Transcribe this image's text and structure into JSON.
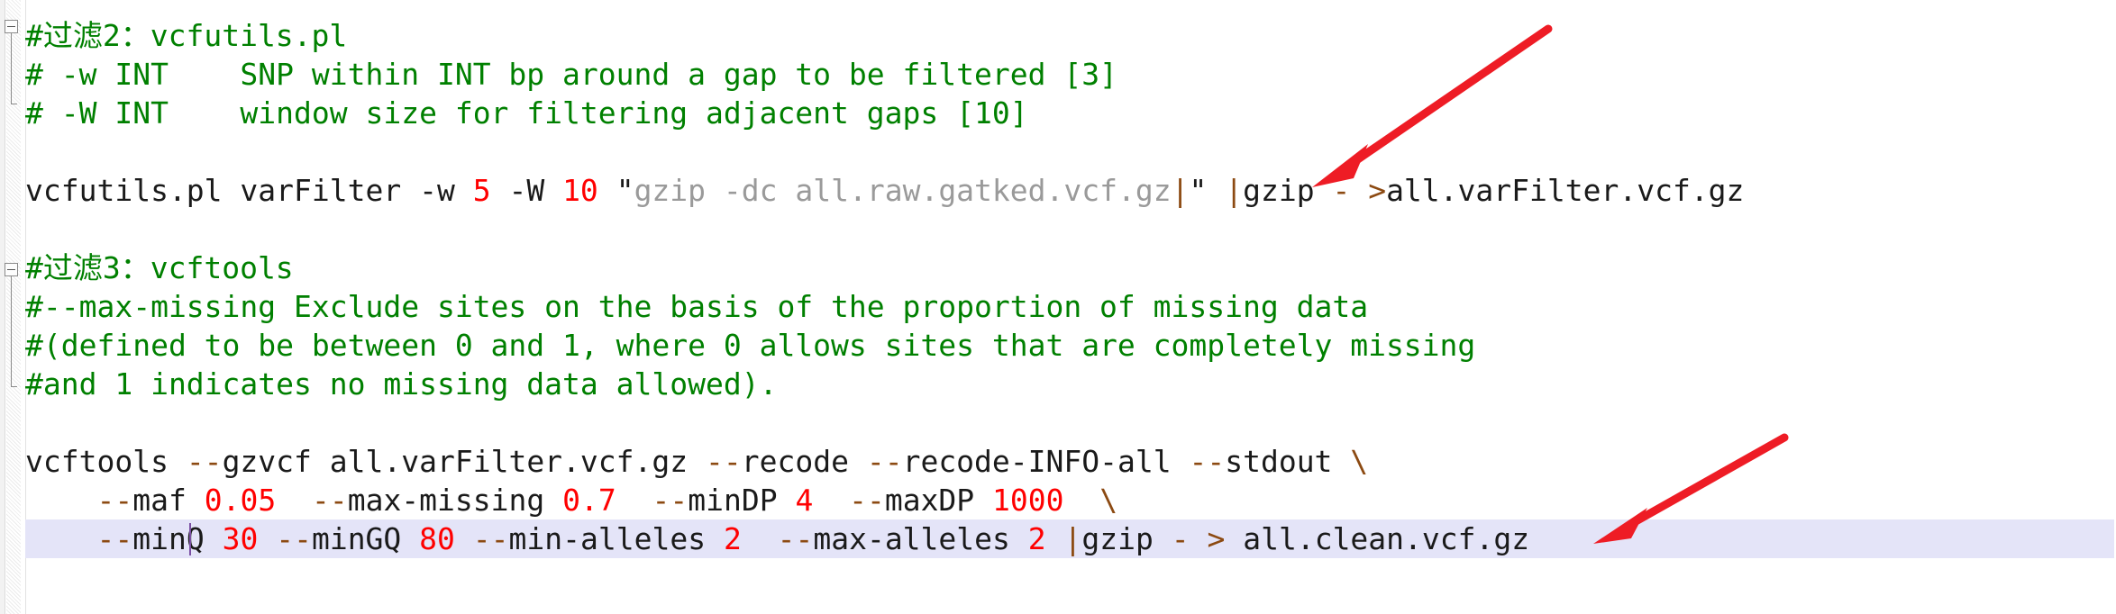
{
  "editor": {
    "title": "code-editor",
    "colors": {
      "comment": "#008000",
      "text": "#1a1a1a",
      "number": "#ff0000",
      "string": "#9a9a9a",
      "operator": "#8c4a12",
      "current_line_highlight": "#e4e4f8",
      "annotation_arrow": "#ee1c25",
      "background": "#ffffff"
    },
    "lines": [
      {
        "id": 1,
        "kind": "comment",
        "fold": "open",
        "text": "#过滤2：vcfutils.pl",
        "tokens": [
          {
            "t": "#过滤2：vcfutils.pl",
            "c": "comment"
          }
        ]
      },
      {
        "id": 2,
        "kind": "comment",
        "text": "# -w INT    SNP within INT bp around a gap to be filtered [3]",
        "tokens": [
          {
            "t": "# -w INT    SNP within INT bp around a gap to be filtered [3]",
            "c": "comment"
          }
        ]
      },
      {
        "id": 3,
        "kind": "comment",
        "text": "# -W INT    window size for filtering adjacent gaps [10]",
        "tokens": [
          {
            "t": "# -W INT    window size for filtering adjacent gaps [10]",
            "c": "comment"
          }
        ]
      },
      {
        "id": 4,
        "kind": "blank",
        "text": "",
        "tokens": []
      },
      {
        "id": 5,
        "kind": "command",
        "text": "vcfutils.pl varFilter -w 5 -W 10 \"gzip -dc all.raw.gatked.vcf.gz|\" |gzip - >all.varFilter.vcf.gz",
        "tokens": [
          {
            "t": "vcfutils.pl varFilter -w ",
            "c": "text"
          },
          {
            "t": "5",
            "c": "number"
          },
          {
            "t": " -W ",
            "c": "text"
          },
          {
            "t": "10",
            "c": "number"
          },
          {
            "t": " ",
            "c": "text"
          },
          {
            "t": "\"",
            "c": "text"
          },
          {
            "t": "gzip -dc all.raw.gatked.vcf.gz",
            "c": "string"
          },
          {
            "t": "|",
            "c": "operator"
          },
          {
            "t": "\"",
            "c": "text"
          },
          {
            "t": " ",
            "c": "text"
          },
          {
            "t": "|",
            "c": "operator"
          },
          {
            "t": "gzip ",
            "c": "text"
          },
          {
            "t": "-",
            "c": "operator"
          },
          {
            "t": " ",
            "c": "text"
          },
          {
            "t": ">",
            "c": "operator"
          },
          {
            "t": "all.varFilter.vcf.gz",
            "c": "text"
          }
        ]
      },
      {
        "id": 6,
        "kind": "blank",
        "text": "",
        "tokens": []
      },
      {
        "id": 7,
        "kind": "comment",
        "fold": "open",
        "text": "#过滤3：vcftools",
        "tokens": [
          {
            "t": "#过滤3：vcftools",
            "c": "comment"
          }
        ]
      },
      {
        "id": 8,
        "kind": "comment",
        "text": "#--max-missing Exclude sites on the basis of the proportion of missing data",
        "tokens": [
          {
            "t": "#--max-missing Exclude sites on the basis of the proportion of missing data",
            "c": "comment"
          }
        ]
      },
      {
        "id": 9,
        "kind": "comment",
        "text": "#(defined to be between 0 and 1, where 0 allows sites that are completely missing",
        "tokens": [
          {
            "t": "#(defined to be between 0 and 1, where 0 allows sites that are completely missing",
            "c": "comment"
          }
        ]
      },
      {
        "id": 10,
        "kind": "comment",
        "text": "#and 1 indicates no missing data allowed).",
        "tokens": [
          {
            "t": "#and 1 indicates no missing data allowed).",
            "c": "comment"
          }
        ]
      },
      {
        "id": 11,
        "kind": "blank",
        "text": "",
        "tokens": []
      },
      {
        "id": 12,
        "kind": "command",
        "text": "vcftools --gzvcf all.varFilter.vcf.gz --recode --recode-INFO-all --stdout \\",
        "tokens": [
          {
            "t": "vcftools ",
            "c": "text"
          },
          {
            "t": "--",
            "c": "operator"
          },
          {
            "t": "gzvcf all.varFilter.vcf.gz ",
            "c": "text"
          },
          {
            "t": "--",
            "c": "operator"
          },
          {
            "t": "recode ",
            "c": "text"
          },
          {
            "t": "--",
            "c": "operator"
          },
          {
            "t": "recode-INFO-all ",
            "c": "text"
          },
          {
            "t": "--",
            "c": "operator"
          },
          {
            "t": "stdout ",
            "c": "text"
          },
          {
            "t": "\\",
            "c": "operator"
          }
        ]
      },
      {
        "id": 13,
        "kind": "command",
        "text": "    --maf 0.05  --max-missing 0.7  --minDP 4  --maxDP 1000  \\",
        "tokens": [
          {
            "t": "    ",
            "c": "text"
          },
          {
            "t": "--",
            "c": "operator"
          },
          {
            "t": "maf ",
            "c": "text"
          },
          {
            "t": "0.05",
            "c": "number"
          },
          {
            "t": "  ",
            "c": "text"
          },
          {
            "t": "--",
            "c": "operator"
          },
          {
            "t": "max-missing ",
            "c": "text"
          },
          {
            "t": "0.7",
            "c": "number"
          },
          {
            "t": "  ",
            "c": "text"
          },
          {
            "t": "--",
            "c": "operator"
          },
          {
            "t": "minDP ",
            "c": "text"
          },
          {
            "t": "4",
            "c": "number"
          },
          {
            "t": "  ",
            "c": "text"
          },
          {
            "t": "--",
            "c": "operator"
          },
          {
            "t": "maxDP ",
            "c": "text"
          },
          {
            "t": "1000",
            "c": "number"
          },
          {
            "t": "  ",
            "c": "text"
          },
          {
            "t": "\\",
            "c": "operator"
          }
        ]
      },
      {
        "id": 14,
        "kind": "command",
        "current": true,
        "text": "    --minQ 30 --minGQ 80 --min-alleles 2  --max-alleles 2 |gzip - > all.clean.vcf.gz",
        "tokens": [
          {
            "t": "    ",
            "c": "text"
          },
          {
            "t": "--",
            "c": "operator"
          },
          {
            "t": "minQ ",
            "c": "text"
          },
          {
            "t": "30",
            "c": "number"
          },
          {
            "t": " ",
            "c": "text"
          },
          {
            "t": "--",
            "c": "operator"
          },
          {
            "t": "minGQ ",
            "c": "text"
          },
          {
            "t": "80",
            "c": "number"
          },
          {
            "t": " ",
            "c": "text"
          },
          {
            "t": "--",
            "c": "operator"
          },
          {
            "t": "min-alleles ",
            "c": "text"
          },
          {
            "t": "2",
            "c": "number"
          },
          {
            "t": "  ",
            "c": "text"
          },
          {
            "t": "--",
            "c": "operator"
          },
          {
            "t": "max-alleles ",
            "c": "text"
          },
          {
            "t": "2",
            "c": "number"
          },
          {
            "t": " ",
            "c": "text"
          },
          {
            "t": "|",
            "c": "operator"
          },
          {
            "t": "gzip ",
            "c": "text"
          },
          {
            "t": "-",
            "c": "operator"
          },
          {
            "t": " ",
            "c": "text"
          },
          {
            "t": ">",
            "c": "operator"
          },
          {
            "t": " all.clean.vcf.gz",
            "c": "text"
          }
        ]
      }
    ],
    "annotations": [
      {
        "name": "arrow-to-gzip-quote",
        "color": "#ee1c25"
      },
      {
        "name": "arrow-to-line-continuation",
        "color": "#ee1c25"
      }
    ],
    "caret": {
      "line": 14,
      "after_text": "--m"
    }
  }
}
